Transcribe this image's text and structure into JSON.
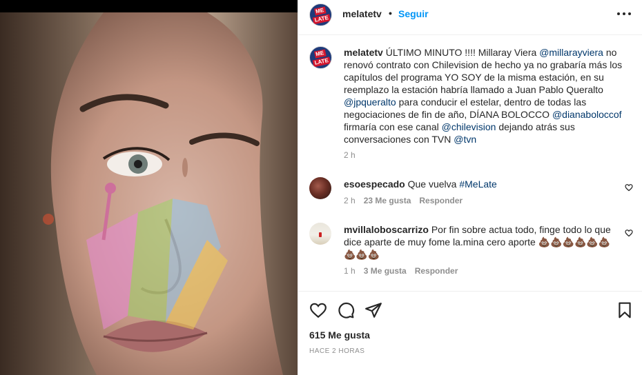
{
  "post": {
    "username": "melatetv",
    "separator": "•",
    "follow_label": "Seguir",
    "avatar_logo": [
      "ME",
      "LATE"
    ],
    "more_icon": "more-options-icon"
  },
  "caption": {
    "username": "melatetv",
    "segments": [
      {
        "text": "ÚLTIMO MINUTO !!!! Millaray Viera ",
        "mention": false
      },
      {
        "text": "@millarayviera",
        "mention": true
      },
      {
        "text": " no renovó contrato con Chilevision de hecho ya no grabaría más los capítulos del programa YO SOY de la misma estación, en su reemplazo la estación habría llamado a Juan Pablo Queralto ",
        "mention": false
      },
      {
        "text": "@jpqueralto",
        "mention": true
      },
      {
        "text": " para conducir el estelar, dentro de todas las negociaciones de fin de año, DÍANA BOLOCCO ",
        "mention": false
      },
      {
        "text": "@dianabolоccof",
        "mention": true
      },
      {
        "text": " firmaría con ese canal ",
        "mention": false
      },
      {
        "text": "@chilevision",
        "mention": true
      },
      {
        "text": " dejando atrás sus conversaciones con TVN ",
        "mention": false
      },
      {
        "text": "@tvn",
        "mention": true
      }
    ],
    "time": "2 h"
  },
  "comments": [
    {
      "username": "esoespecado",
      "text": "Que vuelva ",
      "hashtag": "#MeLate",
      "time": "2 h",
      "likes": "23 Me gusta",
      "reply": "Responder"
    },
    {
      "username": "mvillaloboscarrizo",
      "text": "Por fin sobre actua todo, finge todo lo que dice aparte de muy fome la.mina cero aporte 💩💩💩💩💩💩💩💩💩",
      "time": "1 h",
      "likes": "3 Me gusta",
      "reply": "Responder"
    }
  ],
  "footer": {
    "likes": "615 Me gusta",
    "ago": "HACE 2 HORAS"
  },
  "colors": {
    "link": "#0095f6",
    "mention": "#00376b",
    "muted": "#8e8e8e",
    "text": "#262626"
  }
}
